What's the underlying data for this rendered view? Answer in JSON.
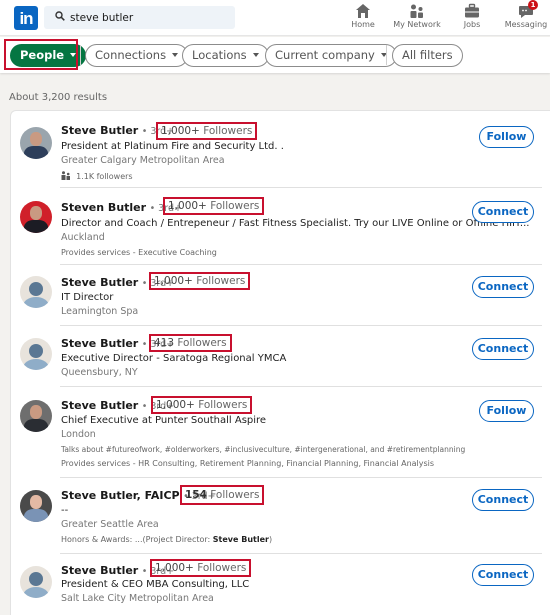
{
  "header": {
    "logo": "in",
    "search": {
      "value": "steve butler",
      "placeholder": "Search"
    },
    "nav": [
      {
        "label": "Home",
        "icon": "home-icon"
      },
      {
        "label": "My Network",
        "icon": "network-icon"
      },
      {
        "label": "Jobs",
        "icon": "briefcase-icon"
      },
      {
        "label": "Messaging",
        "icon": "messaging-icon",
        "badge": "1"
      }
    ]
  },
  "filters": {
    "people": "People",
    "connections": "Connections",
    "locations": "Locations",
    "current_company": "Current company",
    "all_filters": "All filters"
  },
  "results_count": "About 3,200 results",
  "colors": {
    "brand": "#0a66c2",
    "active_filter": "#057642",
    "highlight": "#c8102e"
  },
  "results": [
    {
      "name": "Steve Butler",
      "degree": "• 3rd+",
      "followers_num": "1,000+",
      "followers_label": "Followers",
      "headline": "President at Platinum Fire and Security Ltd. .",
      "location": "Greater Calgary Metropolitan Area",
      "extra": [
        "1.1K followers"
      ],
      "action": "Follow"
    },
    {
      "name": "Steven Butler",
      "degree": "• 3rd+",
      "followers_num": "1,000+",
      "followers_label": "Followers",
      "headline": "Director and Coach / Entrepeneur / Fast Fitness Specialist. Try our LIVE Online or Offline HIIT...",
      "location": "Auckland",
      "extra": [
        "Provides services - Executive Coaching"
      ],
      "action": "Connect"
    },
    {
      "name": "Steve Butler",
      "degree": "• 3rd+",
      "followers_num": "1,000+",
      "followers_label": "Followers",
      "headline": "IT Director",
      "location": "Leamington Spa",
      "extra": [],
      "action": "Connect"
    },
    {
      "name": "Steve Butler",
      "degree": "• 3rd+",
      "followers_num": "413",
      "followers_label": "Followers",
      "headline": "Executive Director - Saratoga Regional YMCA",
      "location": "Queensbury, NY",
      "extra": [],
      "action": "Connect"
    },
    {
      "name": "Steve Butler",
      "degree": "• 3rd+",
      "followers_num": "1,000+",
      "followers_label": "Followers",
      "headline": "Chief Executive at Punter Southall Aspire",
      "location": "London",
      "extra": [
        "Talks about #futureofwork, #olderworkers, #inclusiveculture, #intergenerational, and #retirementplanning",
        "Provides services - HR Consulting, Retirement Planning, Financial Planning, Financial Analysis"
      ],
      "action": "Follow"
    },
    {
      "name": "Steve Butler, FAICP",
      "degree": "• 3rd+",
      "followers_num": "154",
      "followers_label": "Followers",
      "headline": "--",
      "location": "Greater Seattle Area",
      "extra_prefix": "Honors & Awards: ...(Project Director: ",
      "extra_bold": "Steve Butler",
      "extra_suffix": ")",
      "action": "Connect"
    },
    {
      "name": "Steve Butler",
      "degree": "• 3rd+",
      "followers_num": "1,000+",
      "followers_label": "Followers",
      "headline": "President & CEO MBA Consulting, LLC",
      "location": "Salt Lake City Metropolitan Area",
      "extra": [],
      "action": "Connect"
    }
  ]
}
